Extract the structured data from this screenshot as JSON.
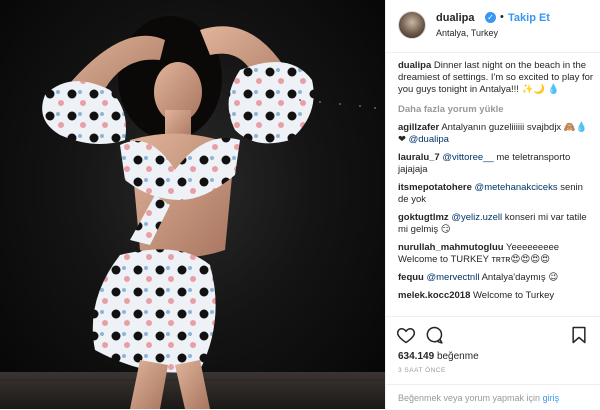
{
  "post": {
    "username": "dualipa",
    "follow_label": "Takip Et",
    "location": "Antalya, Turkey",
    "caption_user": "dualipa",
    "caption": "Dinner last night on the beach in the dreamiest of settings. I'm so excited to play for you guys tonight in Antalya!!! ✨🌙",
    "load_more": "Daha fazla yorum yükle",
    "comments": [
      {
        "user": "agillzafer",
        "text": "Antalyanın guzeliiiiii svajbdjx 🙈💧❤",
        "mention": "@dualipa",
        "tail": ""
      },
      {
        "user": "lauralu_7",
        "text": "",
        "mention": "@vittoree__",
        "tail": "me teletransporto jajajaja"
      },
      {
        "user": "itsmepotatohere",
        "text": "",
        "mention": "@metehanakciceks",
        "tail": "senin de yok"
      },
      {
        "user": "goktugtlmz",
        "text": "",
        "mention": "@yeliz.uzell",
        "tail": "konseri mi var tatile mi gelmiş 😏"
      },
      {
        "user": "nurullah_mahmutogluu",
        "text": "Yeeeeeeeee Welcome to TURKEY ᴛʀᴛʀ😍😍😍😍",
        "mention": "",
        "tail": ""
      },
      {
        "user": "fequu",
        "text": "",
        "mention": "@mervectnll",
        "tail": "Antalya'daymış 😉"
      },
      {
        "user": "melek.kocc2018",
        "text": "Welcome to Turkey",
        "mention": "",
        "tail": ""
      }
    ],
    "likes_count": "634.149",
    "likes_label": "beğenme",
    "time_ago": "3 SAAT ÖNCE",
    "add_comment_text": "Beğenmek veya yorum yapmak için",
    "login_link": "giriş"
  },
  "colors": {
    "accent": "#3897f0",
    "text": "#262626",
    "muted": "#999999",
    "mention": "#003569"
  }
}
